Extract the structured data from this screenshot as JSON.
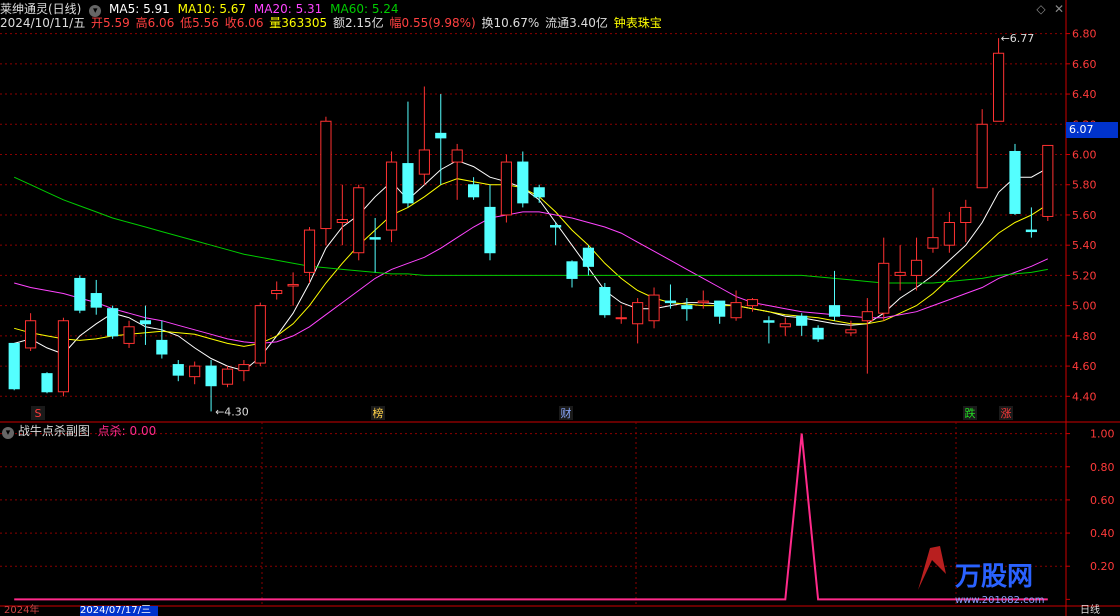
{
  "header": {
    "title": "莱绅通灵(日线)",
    "ma5": "MA5: 5.91",
    "ma10": "MA10: 5.67",
    "ma20": "MA20: 5.31",
    "ma60": "MA60: 5.24",
    "date": "2024/10/11/五",
    "open": "开5.59",
    "high": "高6.06",
    "low": "低5.56",
    "close": "收6.06",
    "volume": "量363305",
    "amount": "额2.15亿",
    "change": "幅0.55(9.98%)",
    "turnover": "换10.67%",
    "float_cap": "流通3.40亿",
    "indicator_name": "钟表珠宝"
  },
  "subchart": {
    "title": "战牛点杀副图",
    "value_label": "点杀: 0.00"
  },
  "price_tag": "6.07",
  "annotations": {
    "low_label": "4.30",
    "high_label": "6.77",
    "marks": [
      "S",
      "榜",
      "财",
      "跌",
      "涨"
    ]
  },
  "bottom": {
    "left_text": "2024年",
    "date_box": "2024/07/17/三",
    "right_text": "日线"
  },
  "watermark": {
    "brand": "万股网",
    "url": "www.201082.com"
  },
  "colors": {
    "up": "#ff3232",
    "down": "#54ffff",
    "ma5": "#ffffff",
    "ma10": "#ffff00",
    "ma20": "#ff44ff",
    "ma60": "#00cc00",
    "spike": "#ff2a8a",
    "grid": "#8b0000",
    "axis": "#cc0000"
  },
  "chart_data": [
    {
      "type": "candlestick",
      "title": "莱绅通灵(日线)",
      "y_ticks": [
        "4.40",
        "4.60",
        "4.80",
        "5.00",
        "5.20",
        "5.40",
        "5.60",
        "5.80",
        "6.00",
        "6.20",
        "6.40",
        "6.60",
        "6.80"
      ],
      "ylim": [
        4.23,
        6.89
      ],
      "candles": [
        [
          4.75,
          4.45,
          4.74,
          4.44
        ],
        [
          4.72,
          4.9,
          4.95,
          4.7
        ],
        [
          4.55,
          4.43,
          4.56,
          4.42
        ],
        [
          4.43,
          4.9,
          4.92,
          4.4
        ],
        [
          5.18,
          4.97,
          5.2,
          4.95
        ],
        [
          5.08,
          4.99,
          5.17,
          4.94
        ],
        [
          4.98,
          4.8,
          5.0,
          4.78
        ],
        [
          4.75,
          4.86,
          4.9,
          4.72
        ],
        [
          4.9,
          4.88,
          5.0,
          4.74
        ],
        [
          4.77,
          4.68,
          4.9,
          4.65
        ],
        [
          4.61,
          4.54,
          4.64,
          4.5
        ],
        [
          4.53,
          4.6,
          4.63,
          4.48
        ],
        [
          4.6,
          4.47,
          4.64,
          4.3
        ],
        [
          4.48,
          4.58,
          4.6,
          4.46
        ],
        [
          4.57,
          4.61,
          4.64,
          4.5
        ],
        [
          4.62,
          5.0,
          5.02,
          4.6
        ],
        [
          5.08,
          5.1,
          5.16,
          5.04
        ],
        [
          5.13,
          5.14,
          5.22,
          5.0
        ],
        [
          5.22,
          5.5,
          5.52,
          5.15
        ],
        [
          5.51,
          6.22,
          6.25,
          5.4
        ],
        [
          5.55,
          5.57,
          5.8,
          5.4
        ],
        [
          5.35,
          5.78,
          5.8,
          5.3
        ],
        [
          5.45,
          5.44,
          5.58,
          5.22
        ],
        [
          5.5,
          5.95,
          6.02,
          5.42
        ],
        [
          5.94,
          5.68,
          6.35,
          5.65
        ],
        [
          5.87,
          6.03,
          6.45,
          5.8
        ],
        [
          6.14,
          6.11,
          6.4,
          5.8
        ],
        [
          5.95,
          6.03,
          6.07,
          5.7
        ],
        [
          5.8,
          5.72,
          5.85,
          5.7
        ],
        [
          5.65,
          5.35,
          5.8,
          5.3
        ],
        [
          5.6,
          5.95,
          6.0,
          5.55
        ],
        [
          5.95,
          5.68,
          6.02,
          5.65
        ],
        [
          5.78,
          5.72,
          5.8,
          5.68
        ],
        [
          5.53,
          5.52,
          5.55,
          5.4
        ],
        [
          5.29,
          5.18,
          5.3,
          5.12
        ],
        [
          5.38,
          5.26,
          5.4,
          5.2
        ],
        [
          5.12,
          4.94,
          5.15,
          4.92
        ],
        [
          4.92,
          4.92,
          5.0,
          4.88
        ],
        [
          4.88,
          5.02,
          5.05,
          4.75
        ],
        [
          4.9,
          5.07,
          5.12,
          4.85
        ],
        [
          5.03,
          5.02,
          5.14,
          4.98
        ],
        [
          5.0,
          4.98,
          5.05,
          4.9
        ],
        [
          5.02,
          5.03,
          5.1,
          4.98
        ],
        [
          5.03,
          4.93,
          5.03,
          4.88
        ],
        [
          4.92,
          5.02,
          5.1,
          4.9
        ],
        [
          5.0,
          5.04,
          5.05,
          4.96
        ],
        [
          4.9,
          4.89,
          4.93,
          4.75
        ],
        [
          4.86,
          4.88,
          4.92,
          4.8
        ],
        [
          4.93,
          4.87,
          4.95,
          4.8
        ],
        [
          4.85,
          4.78,
          4.87,
          4.76
        ],
        [
          5.0,
          4.93,
          5.23,
          4.9
        ],
        [
          4.82,
          4.84,
          4.9,
          4.8
        ],
        [
          4.9,
          4.96,
          5.05,
          4.55
        ],
        [
          4.95,
          5.28,
          5.45,
          4.9
        ],
        [
          5.2,
          5.22,
          5.4,
          5.1
        ],
        [
          5.2,
          5.3,
          5.45,
          5.1
        ],
        [
          5.38,
          5.45,
          5.78,
          5.35
        ],
        [
          5.4,
          5.55,
          5.62,
          5.35
        ],
        [
          5.55,
          5.65,
          5.7,
          5.42
        ],
        [
          5.78,
          6.2,
          6.3,
          5.78
        ],
        [
          6.22,
          6.67,
          6.77,
          6.22
        ],
        [
          6.02,
          5.61,
          6.07,
          5.6
        ],
        [
          5.5,
          5.49,
          5.65,
          5.45
        ],
        [
          5.59,
          6.06,
          6.06,
          5.56
        ]
      ],
      "series": [
        {
          "name": "MA5",
          "values": [
            4.75,
            4.78,
            4.72,
            4.68,
            4.8,
            4.88,
            4.95,
            4.92,
            4.86,
            4.84,
            4.8,
            4.72,
            4.65,
            4.6,
            4.57,
            4.66,
            4.8,
            4.95,
            5.15,
            5.38,
            5.52,
            5.6,
            5.72,
            5.82,
            5.7,
            5.8,
            5.9,
            5.96,
            5.92,
            5.85,
            5.82,
            5.78,
            5.7,
            5.55,
            5.4,
            5.25,
            5.1,
            5.02,
            4.98,
            4.98,
            5.0,
            5.02,
            5.02,
            5.01,
            5.0,
            4.98,
            4.96,
            4.93,
            4.92,
            4.9,
            4.88,
            4.87,
            4.88,
            4.95,
            5.05,
            5.12,
            5.2,
            5.3,
            5.4,
            5.55,
            5.75,
            5.85,
            5.85,
            5.91
          ]
        },
        {
          "name": "MA10",
          "values": [
            4.85,
            4.82,
            4.8,
            4.78,
            4.77,
            4.78,
            4.8,
            4.81,
            4.82,
            4.83,
            4.82,
            4.81,
            4.78,
            4.75,
            4.73,
            4.75,
            4.8,
            4.88,
            5.0,
            5.15,
            5.28,
            5.4,
            5.5,
            5.6,
            5.65,
            5.72,
            5.8,
            5.84,
            5.82,
            5.8,
            5.8,
            5.78,
            5.72,
            5.62,
            5.5,
            5.4,
            5.28,
            5.18,
            5.1,
            5.05,
            5.02,
            5.01,
            5.0,
            5.0,
            5.0,
            4.98,
            4.96,
            4.94,
            4.93,
            4.92,
            4.9,
            4.88,
            4.88,
            4.9,
            4.95,
            5.0,
            5.08,
            5.18,
            5.28,
            5.38,
            5.48,
            5.55,
            5.6,
            5.67
          ]
        },
        {
          "name": "MA20",
          "values": [
            5.15,
            5.12,
            5.1,
            5.08,
            5.05,
            5.02,
            4.98,
            4.95,
            4.92,
            4.9,
            4.87,
            4.84,
            4.81,
            4.78,
            4.76,
            4.75,
            4.76,
            4.8,
            4.86,
            4.94,
            5.02,
            5.1,
            5.18,
            5.24,
            5.28,
            5.32,
            5.38,
            5.45,
            5.52,
            5.58,
            5.6,
            5.62,
            5.62,
            5.6,
            5.58,
            5.55,
            5.52,
            5.48,
            5.42,
            5.36,
            5.3,
            5.24,
            5.18,
            5.12,
            5.06,
            5.02,
            5.0,
            4.98,
            4.96,
            4.95,
            4.94,
            4.93,
            4.92,
            4.92,
            4.94,
            4.96,
            5.0,
            5.04,
            5.08,
            5.12,
            5.18,
            5.22,
            5.26,
            5.31
          ]
        },
        {
          "name": "MA60",
          "values": [
            5.85,
            5.8,
            5.75,
            5.7,
            5.66,
            5.62,
            5.58,
            5.55,
            5.52,
            5.49,
            5.46,
            5.43,
            5.4,
            5.37,
            5.34,
            5.32,
            5.3,
            5.28,
            5.26,
            5.25,
            5.24,
            5.23,
            5.22,
            5.21,
            5.21,
            5.2,
            5.2,
            5.2,
            5.2,
            5.2,
            5.2,
            5.2,
            5.2,
            5.2,
            5.2,
            5.2,
            5.2,
            5.2,
            5.2,
            5.2,
            5.2,
            5.2,
            5.2,
            5.2,
            5.2,
            5.2,
            5.2,
            5.2,
            5.2,
            5.19,
            5.18,
            5.17,
            5.16,
            5.15,
            5.15,
            5.15,
            5.15,
            5.16,
            5.17,
            5.18,
            5.2,
            5.21,
            5.22,
            5.24
          ]
        }
      ]
    },
    {
      "type": "line",
      "title": "战牛点杀副图",
      "y_ticks": [
        "0.00",
        "0.20",
        "0.40",
        "0.60",
        "0.80",
        "1.00"
      ],
      "ylim": [
        -0.04,
        1.07
      ],
      "series": [
        {
          "name": "点杀",
          "values": [
            0,
            0,
            0,
            0,
            0,
            0,
            0,
            0,
            0,
            0,
            0,
            0,
            0,
            0,
            0,
            0,
            0,
            0,
            0,
            0,
            0,
            0,
            0,
            0,
            0,
            0,
            0,
            0,
            0,
            0,
            0,
            0,
            0,
            0,
            0,
            0,
            0,
            0,
            0,
            0,
            0,
            0,
            0,
            0,
            0,
            0,
            0,
            0,
            1,
            0,
            0,
            0,
            0,
            0,
            0,
            0,
            0,
            0,
            0,
            0,
            0,
            0,
            0,
            0
          ]
        }
      ]
    }
  ]
}
